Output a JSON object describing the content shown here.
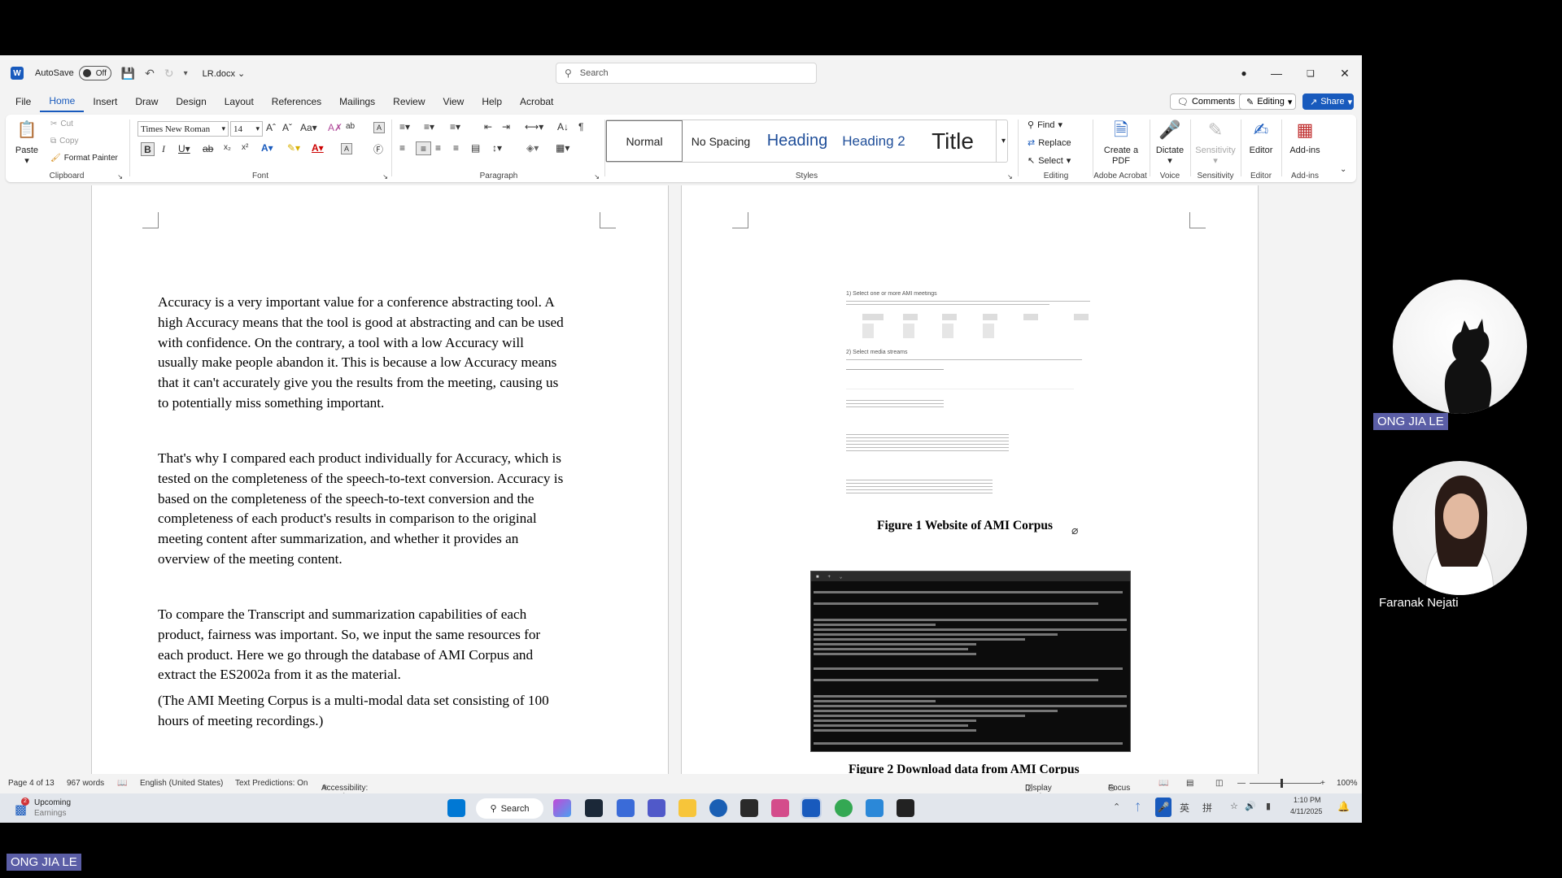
{
  "titlebar": {
    "autosave_label": "AutoSave",
    "autosave_state": "Off",
    "doc_name": "LR.docx",
    "search_placeholder": "Search"
  },
  "menu": {
    "tabs": [
      "File",
      "Home",
      "Insert",
      "Draw",
      "Design",
      "Layout",
      "References",
      "Mailings",
      "Review",
      "View",
      "Help",
      "Acrobat"
    ],
    "active": "Home",
    "comments_label": "Comments",
    "editing_label": "Editing",
    "share_label": "Share"
  },
  "ribbon": {
    "clipboard": {
      "paste": "Paste",
      "cut": "Cut",
      "copy": "Copy",
      "format_painter": "Format Painter",
      "label": "Clipboard"
    },
    "font": {
      "family": "Times New Roman",
      "size": "14",
      "label": "Font"
    },
    "paragraph": {
      "label": "Paragraph"
    },
    "styles": {
      "items": [
        "Normal",
        "No Spacing",
        "Heading",
        "Heading 2",
        "Title"
      ],
      "label": "Styles"
    },
    "editing": {
      "find": "Find",
      "replace": "Replace",
      "select": "Select",
      "label": "Editing"
    },
    "acrobat": {
      "create_pdf": "Create a PDF",
      "label": "Adobe Acrobat"
    },
    "voice": {
      "dictate": "Dictate",
      "label": "Voice"
    },
    "sensitivity": {
      "btn": "Sensitivity",
      "label": "Sensitivity"
    },
    "editor": {
      "btn": "Editor",
      "label": "Editor"
    },
    "addins": {
      "btn": "Add-ins",
      "label": "Add-ins"
    }
  },
  "document": {
    "paragraphs": [
      [
        "Accuracy is a very important value for a conference abstracting tool. A",
        "high Accuracy means that the tool is good at abstracting and can be used",
        "with confidence. On the contrary, a tool with a low Accuracy will",
        "usually make people abandon it. This is because a low Accuracy means",
        "that it can't accurately give you the results from the meeting, causing us",
        "to potentially miss something important."
      ],
      [
        "That's why I compared each product individually for Accuracy, which is",
        "tested on the completeness of the speech-to-text conversion. Accuracy is",
        "based on the completeness of the speech-to-text conversion and the",
        "completeness of each product's results in comparison to the original",
        "meeting content after summarization, and whether it provides an",
        "overview of the meeting content."
      ],
      [
        "To compare the Transcript and summarization capabilities of each",
        "product, fairness was important. So, we input the same resources for",
        "each product. Here we go through the database of AMI Corpus and",
        "extract the ES2002a from it as the material."
      ],
      [
        "(The AMI Meeting Corpus is a multi-modal data set consisting of 100",
        "hours of meeting recordings.)"
      ]
    ],
    "figure1_caption": "Figure 1 Website of AMI Corpus",
    "figure2_caption": "Figure 2 Download data from AMI Corpus",
    "figure1_headings": [
      "1) Select one or more AMI meetings",
      "2) Select media streams"
    ]
  },
  "statusbar": {
    "page": "Page 4 of 13",
    "words": "967 words",
    "language": "English (United States)",
    "predictions": "Text Predictions: On",
    "accessibility": "Accessibility: Investigate",
    "display_settings": "Display Settings",
    "focus": "Focus",
    "zoom": "100%"
  },
  "taskbar": {
    "widget_title": "Upcoming",
    "widget_sub": "Earnings",
    "search_label": "Search",
    "time": "1:10 PM",
    "date": "4/11/2025"
  },
  "participants": {
    "p1": "ONG JIA LE",
    "p2": "Faranak Nejati",
    "self_label": "ONG JIA LE"
  }
}
